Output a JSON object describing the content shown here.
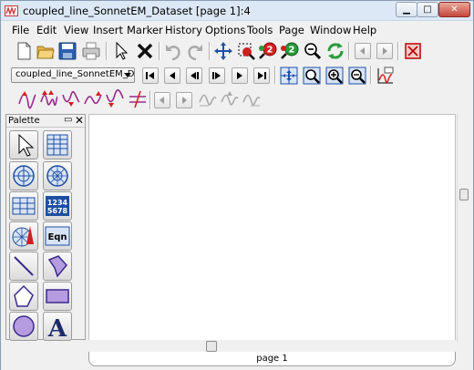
{
  "window": {
    "title": "coupled_line_SonnetEM_Dataset [page 1]:4",
    "min_label": "▁",
    "max_label": "□",
    "close_label": "✕"
  },
  "menu": [
    {
      "label": "File"
    },
    {
      "label": "Edit"
    },
    {
      "label": "View"
    },
    {
      "label": "Insert"
    },
    {
      "label": "Marker"
    },
    {
      "label": "History"
    },
    {
      "label": "Options"
    },
    {
      "label": "Tools"
    },
    {
      "label": "Page"
    },
    {
      "label": "Window"
    },
    {
      "label": "Help"
    }
  ],
  "toolbar2": {
    "dataset_value": "coupled_line_SonnetEM_Data"
  },
  "palette": {
    "title": "Palette",
    "float_icon": "▭",
    "close_icon": "✕",
    "numbers_row1": "1234",
    "numbers_row2": "5678",
    "eqn_label": "Eqn",
    "text_tool_label": "A"
  },
  "page_tab": {
    "label": "page 1"
  },
  "colors": {
    "accent_blue": "#1e4fa3",
    "icon_red": "#d22020",
    "icon_green": "#2a9a3a",
    "trace_purple": "#9a2a8a"
  }
}
